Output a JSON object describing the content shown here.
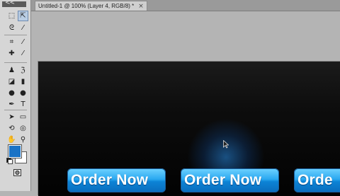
{
  "tools_panel": {
    "grip": "<<",
    "tools": [
      {
        "name": "marquee-tool-icon",
        "glyph": "⬚"
      },
      {
        "name": "move-tool-icon",
        "glyph": "⇱"
      },
      {
        "name": "lasso-tool-icon",
        "glyph": "ᘓ"
      },
      {
        "name": "magic-wand-tool-icon",
        "glyph": "⁄"
      },
      {
        "name": "crop-tool-icon",
        "glyph": "⌗"
      },
      {
        "name": "eyedropper-tool-icon",
        "glyph": "⁄"
      },
      {
        "name": "healing-brush-tool-icon",
        "glyph": "✚"
      },
      {
        "name": "brush-tool-icon",
        "glyph": "⁄"
      },
      {
        "name": "clone-stamp-tool-icon",
        "glyph": "♟"
      },
      {
        "name": "history-brush-tool-icon",
        "glyph": "ℨ"
      },
      {
        "name": "eraser-tool-icon",
        "glyph": "◪"
      },
      {
        "name": "gradient-tool-icon",
        "glyph": "▮"
      },
      {
        "name": "blur-tool-icon",
        "glyph": "●"
      },
      {
        "name": "dodge-tool-icon",
        "glyph": "●"
      },
      {
        "name": "pen-tool-icon",
        "glyph": "✒"
      },
      {
        "name": "type-tool-icon",
        "glyph": "T"
      },
      {
        "name": "path-selection-tool-icon",
        "glyph": "➤"
      },
      {
        "name": "shape-tool-icon",
        "glyph": "▭"
      },
      {
        "name": "3d-rotate-tool-icon",
        "glyph": "⟲"
      },
      {
        "name": "3d-orbit-tool-icon",
        "glyph": "◎"
      },
      {
        "name": "hand-tool-icon",
        "glyph": "✋"
      },
      {
        "name": "zoom-tool-icon",
        "glyph": "⚲"
      }
    ],
    "foreground_color": "#1a73c6",
    "background_color": "#ffffff",
    "quick_mask_icon": "quick-mask-icon"
  },
  "document": {
    "tab_title": "Untitled-1 @ 100% (Layer 4, RGB/8) *",
    "close_glyph": "×"
  },
  "canvas": {
    "buttons": [
      {
        "label": "Order Now"
      },
      {
        "label": "Order Now"
      },
      {
        "label": "Orde"
      }
    ],
    "accent_color": "#2aa8f0",
    "background_color": "#000000"
  }
}
